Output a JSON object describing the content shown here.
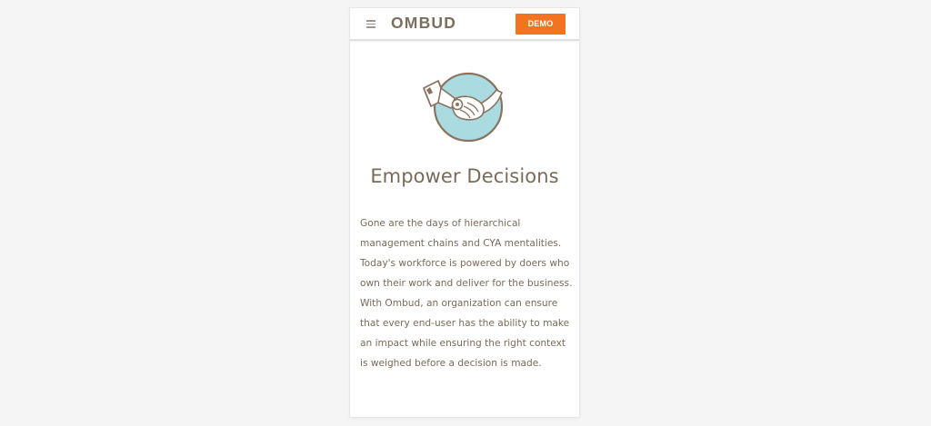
{
  "header": {
    "menu_icon": "hamburger-menu-icon",
    "logo_text": "OMBUD",
    "demo_label": "DEMO"
  },
  "colors": {
    "accent": "#f47321",
    "text": "#7a6a58",
    "logo": "#7d6e5e",
    "icon_circle_fill": "#a9dbe0",
    "icon_stroke": "#8a7360",
    "background": "#f5f5f5"
  },
  "section": {
    "icon": "handshake-icon",
    "title": "Empower Decisions",
    "body": "Gone are the days of hierarchical management chains and CYA mentalities. Today's workforce is powered by doers who own their work and deliver for the business. With Ombud, an organization can ensure that every end-user has the ability to make an impact while ensuring the right context is weighed before a decision is made."
  }
}
